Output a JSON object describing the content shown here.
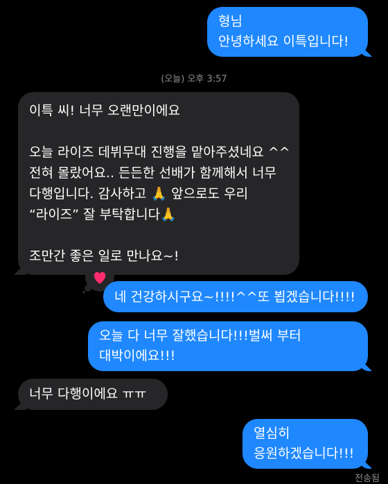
{
  "conversation": {
    "timestamp": "(오늘) 오후 3:57",
    "status": "전송됨",
    "messages": [
      {
        "sender": "me",
        "text": "형님\n안녕하세요 이특입니다!"
      },
      {
        "sender": "other",
        "text": "이특 씨! 너무 오랜만이에요\n\n오늘 라이즈 데뷔무대 진행을 맡아주셨네요 ^^ 전혀 몰랐어요.. 든든한 선배가 함께해서 너무 다행입니다. 감사하고 🙏 앞으로도 우리 “라이즈” 잘 부탁합니다🙏\n\n조만간 좋은 일로 만나요~!"
      },
      {
        "sender": "me",
        "text": "네 건강하시구요~!!!!^^또 뵙겠습니다!!!!",
        "tapback": "heart"
      },
      {
        "sender": "me",
        "text": "오늘 다 너무 잘했습니다!!!벌써 부터 대박이에요!!!"
      },
      {
        "sender": "other",
        "text": "너무 다행이에요 ㅠㅠ"
      },
      {
        "sender": "me",
        "text": "열심히\n응원하겠습니다!!!"
      }
    ]
  },
  "colors": {
    "background": "#000000",
    "sent_bubble": "#1f88fe",
    "received_bubble": "#262628",
    "meta_text": "#8e8e93",
    "heart": "#ff2d6f"
  }
}
